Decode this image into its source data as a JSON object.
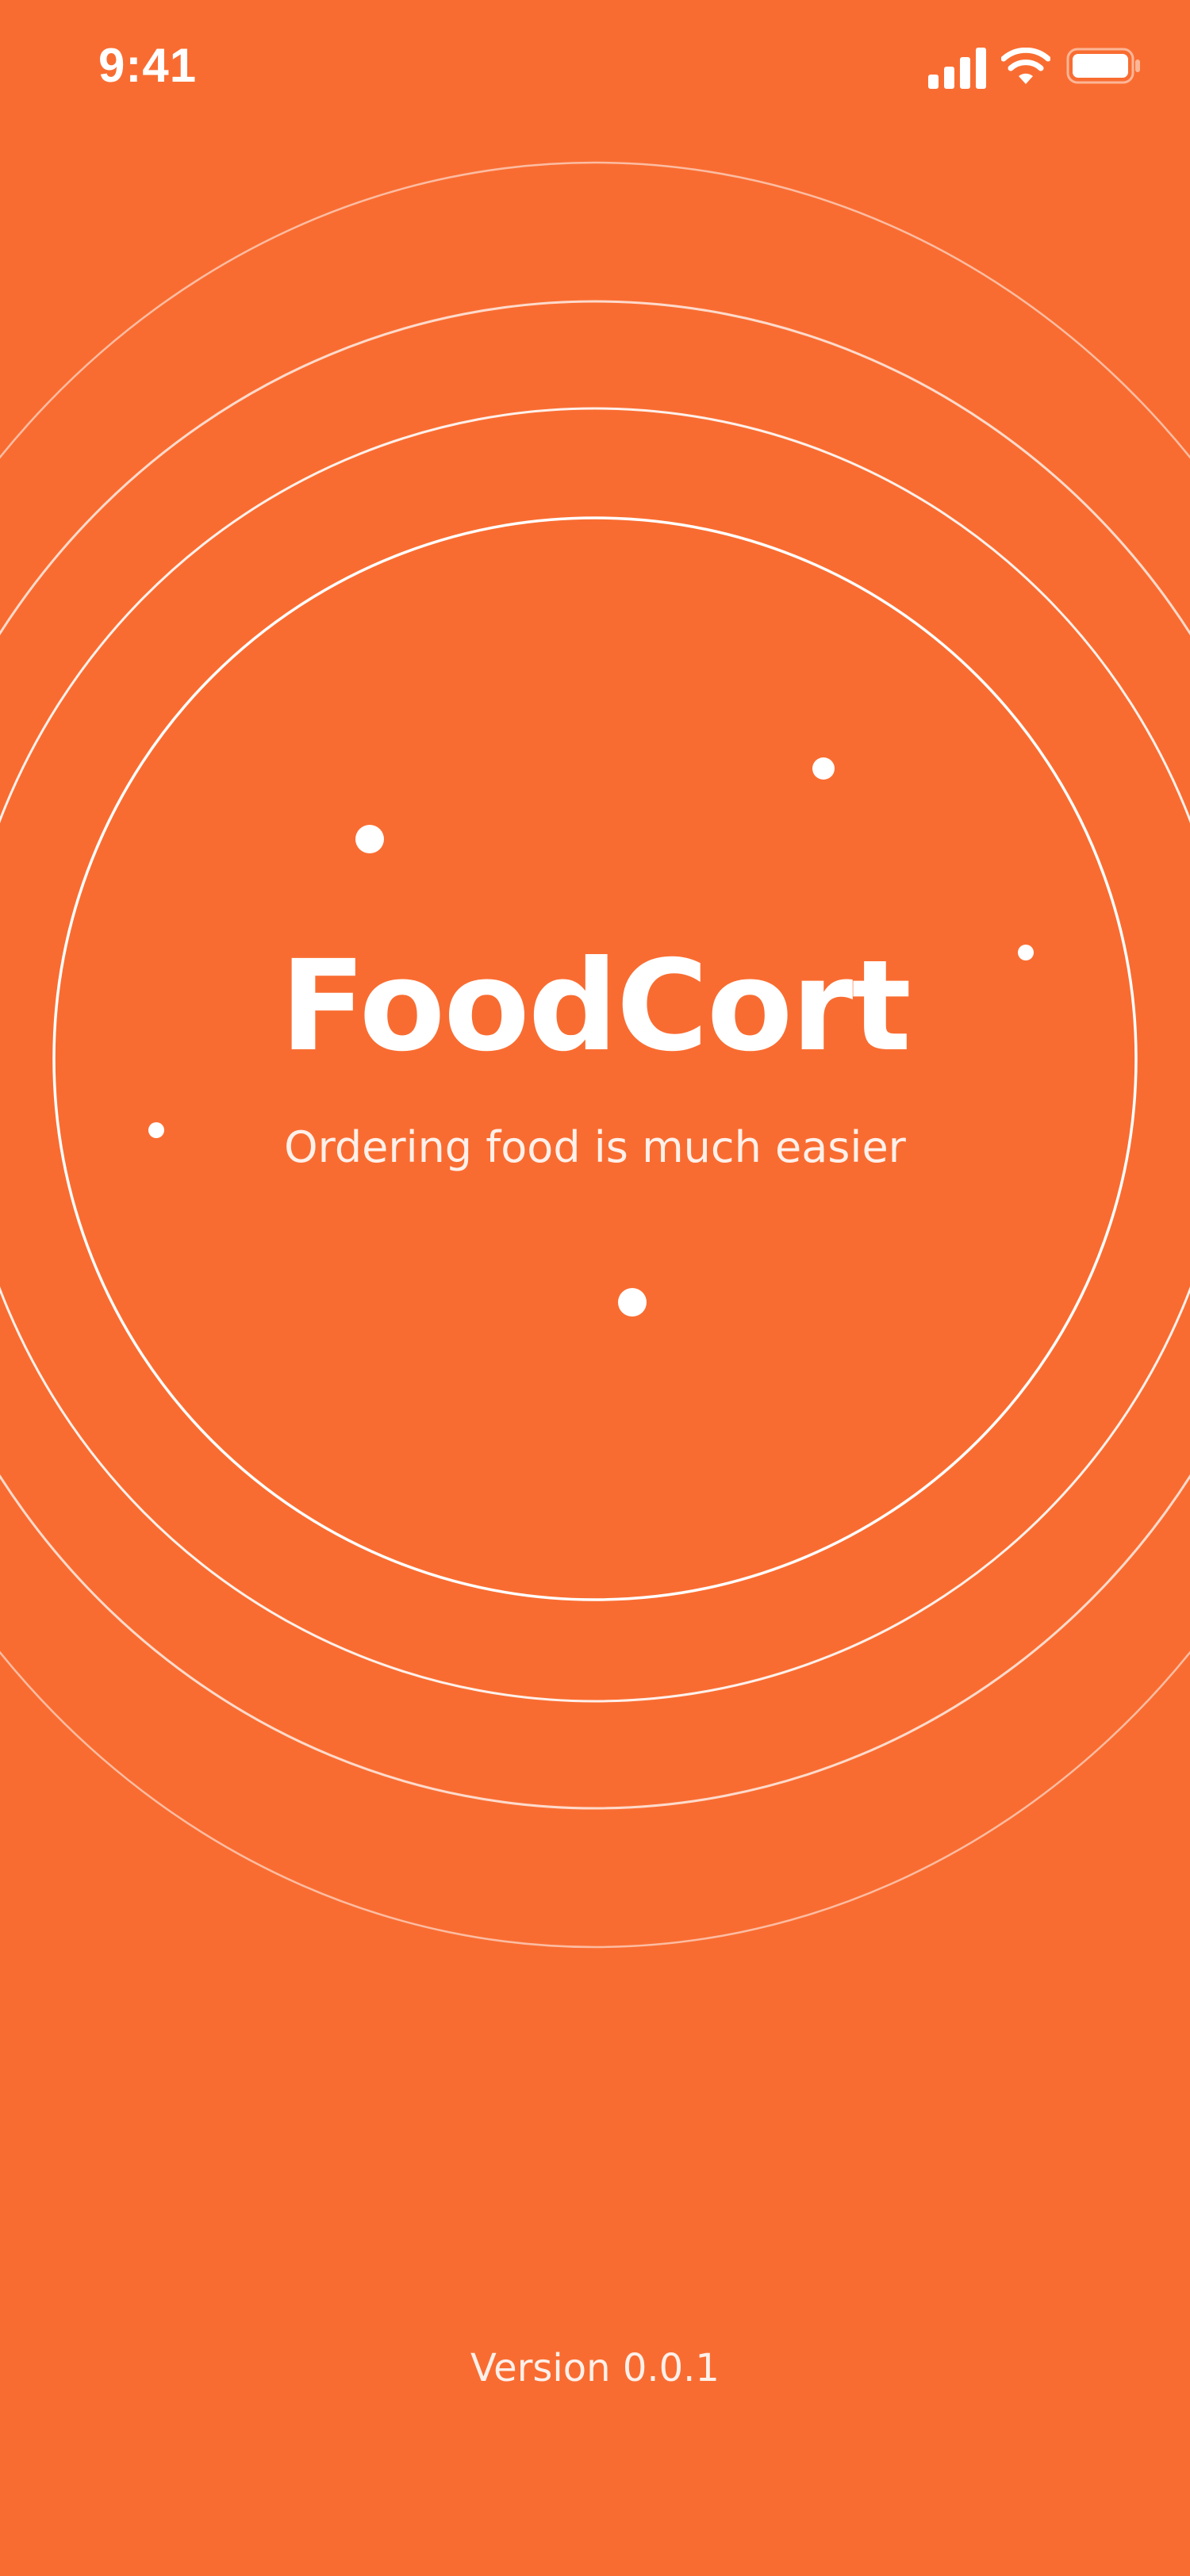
{
  "status_bar": {
    "time": "9:41",
    "icons": [
      "cellular-signal-icon",
      "wifi-icon",
      "battery-icon"
    ]
  },
  "splash": {
    "title": "FoodCort",
    "tagline": "Ordering food is much easier",
    "version": "Version 0.0.1"
  },
  "colors": {
    "background": "#F96C31",
    "foreground": "#FFFFFF"
  }
}
